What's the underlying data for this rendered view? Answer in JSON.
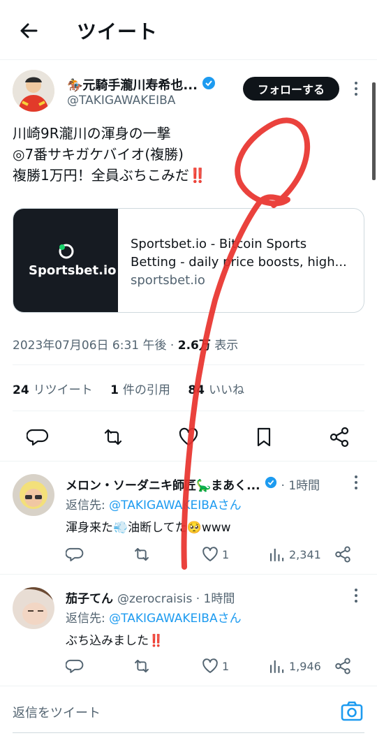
{
  "header": {
    "title": "ツイート"
  },
  "tweet": {
    "author_name": "🏇元騎手瀧川寿希也...",
    "handle": "@TAKIGAWAKEIBA",
    "follow_label": "フォローする",
    "text_line1": "川崎9R瀧川の渾身の一撃",
    "text_line2": "◎7番サキガケバイオ(複勝)",
    "text_line3": "複勝1万円！全員ぶちこみだ‼️",
    "card": {
      "logo_text": "Sportsbet.io",
      "title": "Sportsbet.io - Bitcoin Sports Betting - daily price boosts, high...",
      "domain": "sportsbet.io"
    },
    "timestamp": "2023年07月06日 6:31 午後",
    "views_count": "2.6万",
    "views_label": "表示",
    "retweets_count": "24",
    "retweets_label": "リツイート",
    "quotes_count": "1",
    "quotes_label": "件の引用",
    "likes_count": "84",
    "likes_label": "いいね"
  },
  "replies": [
    {
      "name": "メロン・ソーダニキ師匠🦕まあく...",
      "sub": "· 1時間",
      "reply_to_prefix": "返信先: ",
      "reply_to_handle": "@TAKIGAWAKEIBAさん",
      "text": "渾身来た💨油断してた🥺www",
      "likes": "1",
      "views": "2,341"
    },
    {
      "name": "茄子てん",
      "sub": "@zerocraisis · 1時間",
      "reply_to_prefix": "返信先: ",
      "reply_to_handle": "@TAKIGAWAKEIBAさん",
      "text": "ぶち込みました‼️",
      "likes": "1",
      "views": "1,946"
    }
  ],
  "compose": {
    "placeholder": "返信をツイート"
  },
  "colors": {
    "accent": "#1d9bf0",
    "text": "#0f1419",
    "muted": "#536471",
    "border": "#eff3f4",
    "annotation": "#e8322c"
  }
}
